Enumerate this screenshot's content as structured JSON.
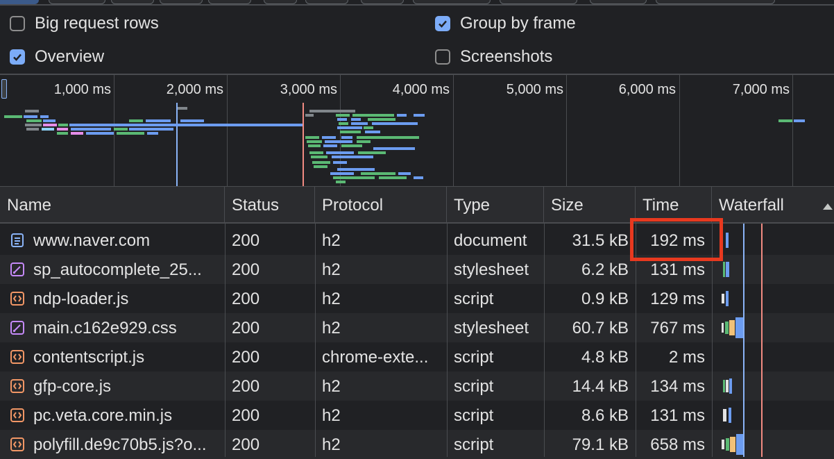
{
  "settings": {
    "big_request_rows": {
      "label": "Big request rows",
      "checked": false
    },
    "group_by_frame": {
      "label": "Group by frame",
      "checked": true
    },
    "overview": {
      "label": "Overview",
      "checked": true
    },
    "screenshots": {
      "label": "Screenshots",
      "checked": false
    }
  },
  "overview": {
    "ticks": [
      "1,000 ms",
      "2,000 ms",
      "3,000 ms",
      "4,000 ms",
      "5,000 ms",
      "6,000 ms",
      "7,000 ms"
    ]
  },
  "table": {
    "headers": {
      "name": "Name",
      "status": "Status",
      "protocol": "Protocol",
      "type": "Type",
      "size": "Size",
      "time": "Time",
      "waterfall": "Waterfall"
    },
    "rows": [
      {
        "name": "www.naver.com",
        "icon": "document-icon",
        "status": "200",
        "protocol": "h2",
        "type": "document",
        "size": "31.5 kB",
        "time": "192 ms"
      },
      {
        "name": "sp_autocomplete_25...",
        "icon": "stylesheet-icon",
        "status": "200",
        "protocol": "h2",
        "type": "stylesheet",
        "size": "6.2 kB",
        "time": "131 ms"
      },
      {
        "name": "ndp-loader.js",
        "icon": "script-icon",
        "status": "200",
        "protocol": "h2",
        "type": "script",
        "size": "0.9 kB",
        "time": "129 ms"
      },
      {
        "name": "main.c162e929.css",
        "icon": "stylesheet-icon",
        "status": "200",
        "protocol": "h2",
        "type": "stylesheet",
        "size": "60.7 kB",
        "time": "767 ms"
      },
      {
        "name": "contentscript.js",
        "icon": "script-icon",
        "status": "200",
        "protocol": "chrome-exte...",
        "type": "script",
        "size": "4.8 kB",
        "time": "2 ms"
      },
      {
        "name": "gfp-core.js",
        "icon": "script-icon",
        "status": "200",
        "protocol": "h2",
        "type": "script",
        "size": "14.4 kB",
        "time": "134 ms"
      },
      {
        "name": "pc.veta.core.min.js",
        "icon": "script-icon",
        "status": "200",
        "protocol": "h2",
        "type": "script",
        "size": "8.6 kB",
        "time": "131 ms"
      },
      {
        "name": "polyfill.de9c70b5.js?o...",
        "icon": "script-icon",
        "status": "200",
        "protocol": "h2",
        "type": "script",
        "size": "79.1 kB",
        "time": "658 ms"
      }
    ]
  },
  "colors": {
    "background": "#202124",
    "accent": "#7cacf8",
    "highlight_box": "#e8391f",
    "document_icon": "#8ab4f8",
    "stylesheet_icon": "#c58af9",
    "script_icon": "#f29766",
    "bar_green": "#5bb974",
    "bar_blue": "#6c9cf0",
    "bar_grey": "#80868b",
    "bar_pink": "#e58de8",
    "dom_content_line": "#8ab4f8",
    "load_line": "#f28b82"
  }
}
